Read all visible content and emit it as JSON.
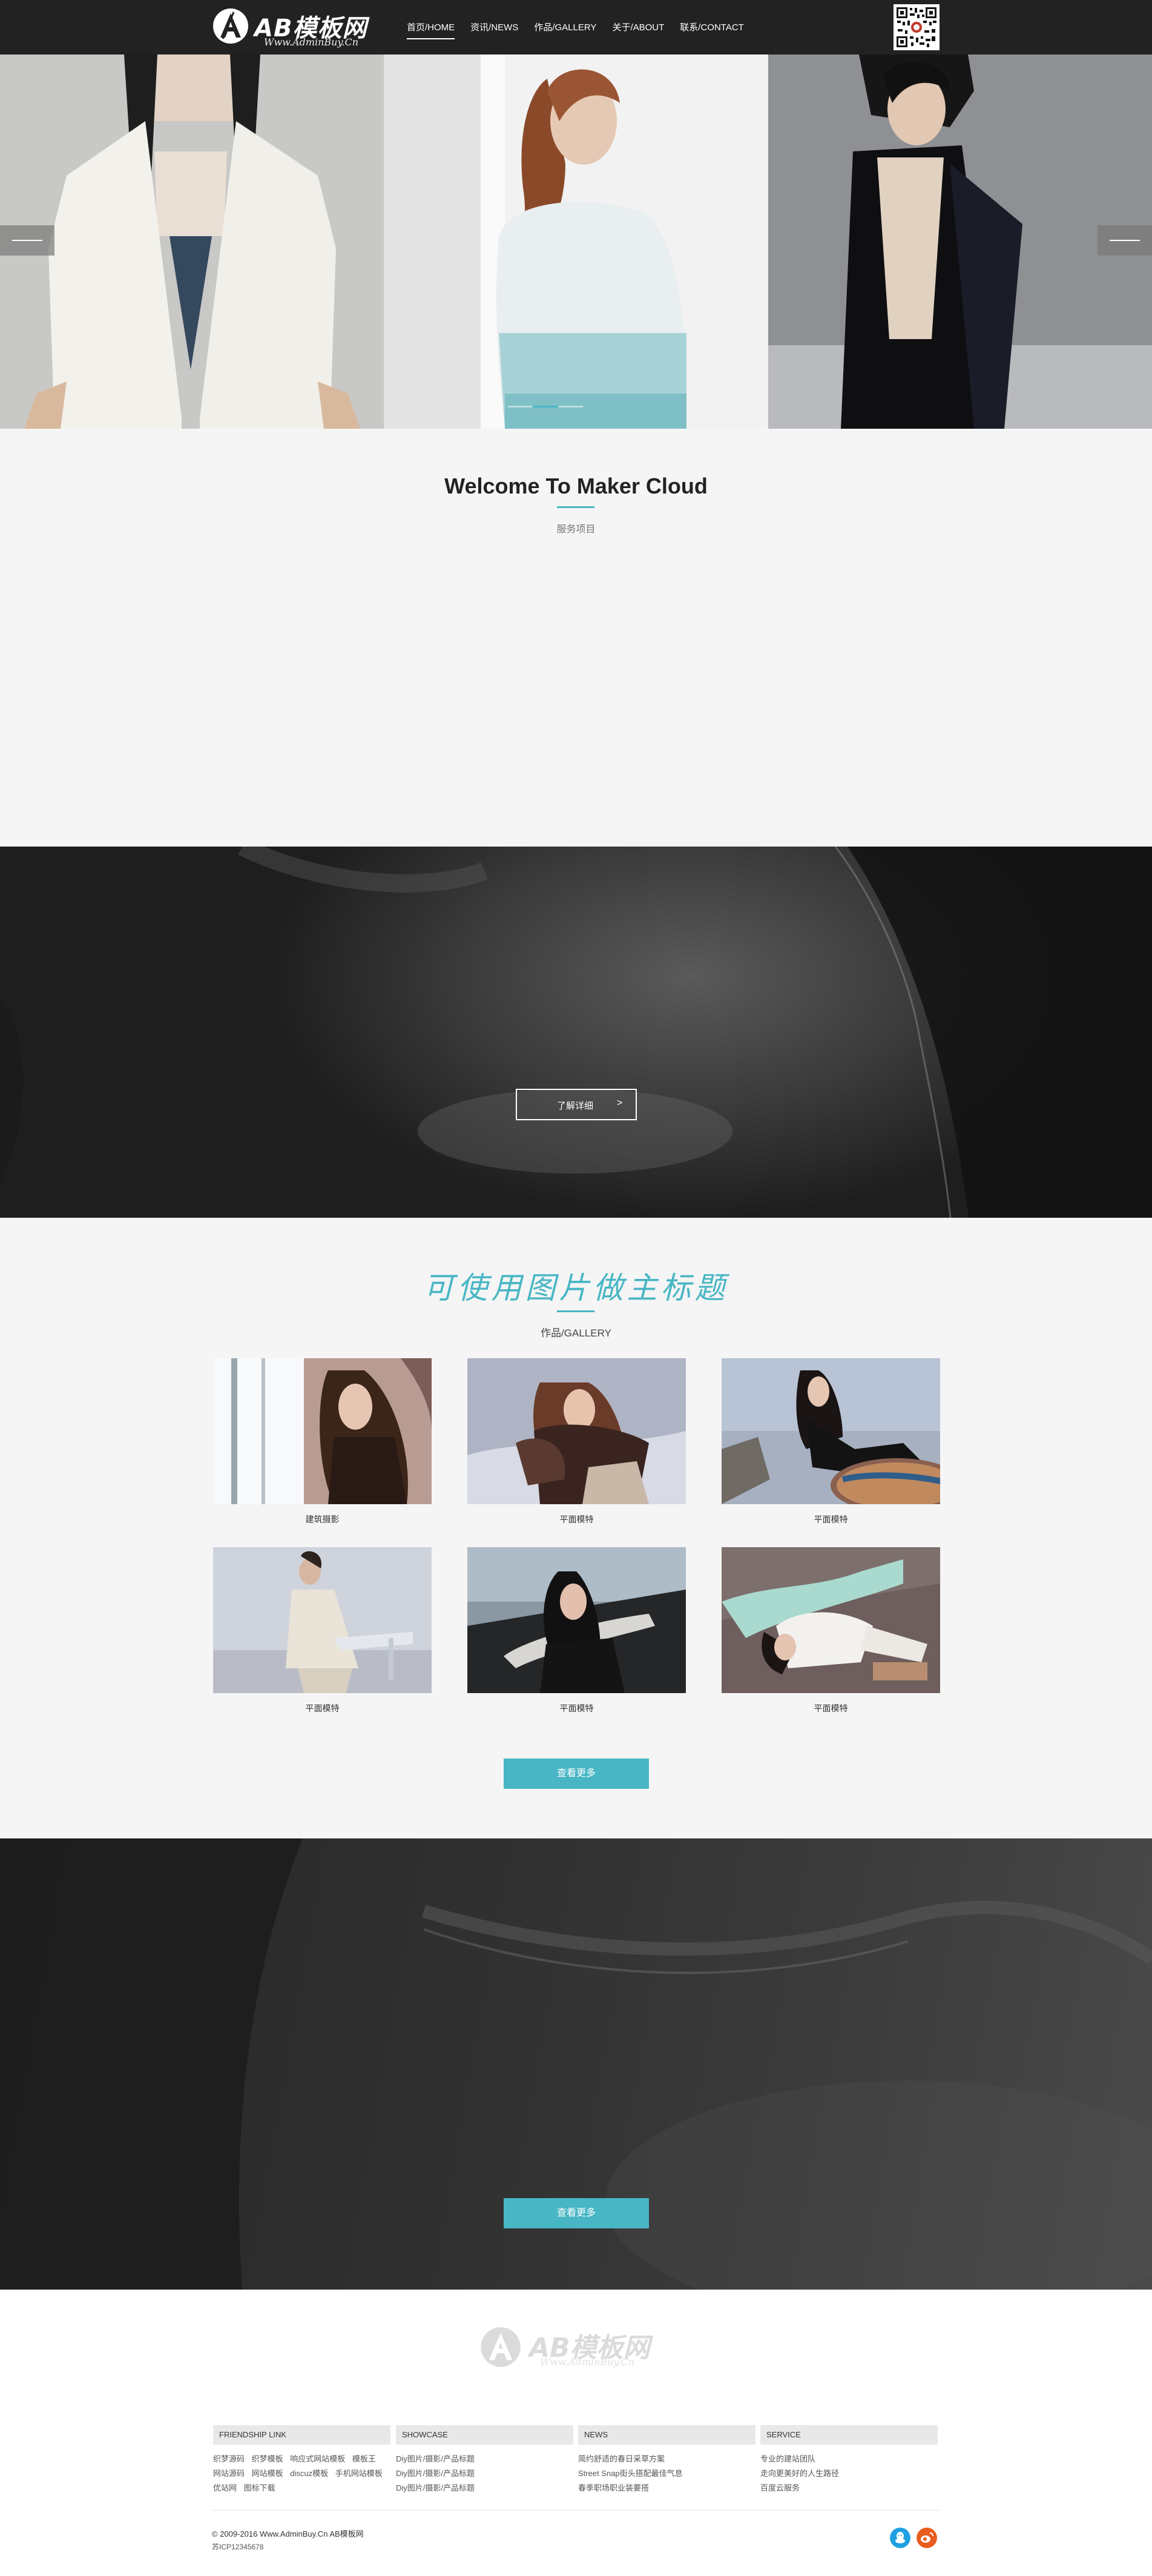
{
  "header": {
    "logo_name": "AB模板网",
    "logo_url": "Www.AdminBuy.Cn",
    "nav": [
      "首页/HOME",
      "资讯/NEWS",
      "作品/GALLERY",
      "关于/ABOUT",
      "联系/CONTACT"
    ],
    "active_nav": 0
  },
  "welcome": {
    "title": "Welcome To Maker Cloud",
    "subtitle": "服务项目"
  },
  "banner2": {
    "button_label": "了解详细",
    "button_arrow": ">"
  },
  "gallery": {
    "title": "可使用图片做主标题",
    "subtitle": "作品/GALLERY",
    "items": [
      {
        "caption": "建筑摄影"
      },
      {
        "caption": "平面模特"
      },
      {
        "caption": "平面模特"
      },
      {
        "caption": "平面模特"
      },
      {
        "caption": "平面模特"
      },
      {
        "caption": "平面模特"
      }
    ],
    "more_label": "查看更多"
  },
  "banner3": {
    "more_label": "查看更多"
  },
  "footer": {
    "logo_name": "AB模板网",
    "logo_url": "Www.AdminBuy.Cn",
    "columns": [
      {
        "title": "FRIENDSHIP LINK",
        "rows": [
          [
            "织梦源码",
            "织梦模板",
            "响应式网站模板",
            "模板王"
          ],
          [
            "网站源码",
            "网站模板",
            "discuz模板",
            "手机网站模板"
          ],
          [
            "优站网",
            "图标下载"
          ]
        ]
      },
      {
        "title": "SHOWCASE",
        "rows": [
          [
            "Diy图片/摄影/产品标题"
          ],
          [
            "Diy图片/摄影/产品标题"
          ],
          [
            "Diy图片/摄影/产品标题"
          ]
        ]
      },
      {
        "title": "NEWS",
        "rows": [
          [
            "简约舒适的春日采草方案"
          ],
          [
            "Street Snap街头搭配最佳气息"
          ],
          [
            "春季职场职业装要搭"
          ]
        ]
      },
      {
        "title": "SERVICE",
        "rows": [
          [
            "专业的建站团队"
          ],
          [
            "走向更美好的人生路径"
          ],
          [
            "百度云服务"
          ]
        ]
      }
    ],
    "copyright": "© 2009-2016 Www.AdminBuy.Cn AB模板网",
    "icp": "苏ICP12345678"
  },
  "colors": {
    "accent": "#48b6c4",
    "header_bg": "#222222",
    "page_bg": "#f5f5f5",
    "qq_icon": "#1ea0e1",
    "weibo_icon": "#e85c1f"
  }
}
